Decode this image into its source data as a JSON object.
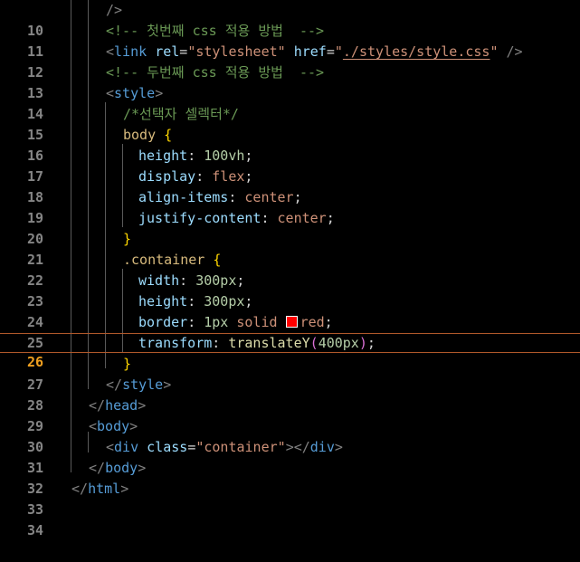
{
  "editor": {
    "current_line": 26,
    "lines": [
      {
        "num": "10",
        "text": "/>"
      },
      {
        "num": "11",
        "text": "<!-- 첫번째 css 적용 방법  -->"
      },
      {
        "num": "12",
        "text": "<link rel=\"stylesheet\" href=\"./styles/style.css\" />"
      },
      {
        "num": "13",
        "text": "<!-- 두번째 css 적용 방법  -->"
      },
      {
        "num": "14",
        "text": "<style>"
      },
      {
        "num": "15",
        "text": "/*선택자 셀렉터*/"
      },
      {
        "num": "16",
        "text": "body {"
      },
      {
        "num": "17",
        "text": "height: 100vh;"
      },
      {
        "num": "18",
        "text": "display: flex;"
      },
      {
        "num": "19",
        "text": "align-items: center;"
      },
      {
        "num": "20",
        "text": "justify-content: center;"
      },
      {
        "num": "21",
        "text": "}"
      },
      {
        "num": "22",
        "text": ".container {"
      },
      {
        "num": "23",
        "text": "width: 300px;"
      },
      {
        "num": "24",
        "text": "height: 300px;"
      },
      {
        "num": "25",
        "text": "border: 1px solid red;"
      },
      {
        "num": "26",
        "text": "transform: translateY(400px);"
      },
      {
        "num": "27",
        "text": "}"
      },
      {
        "num": "28",
        "text": "</style>"
      },
      {
        "num": "29",
        "text": "</head>"
      },
      {
        "num": "30",
        "text": "<body>"
      },
      {
        "num": "31",
        "text": "<div class=\"container\"></div>"
      },
      {
        "num": "32",
        "text": "</body>"
      },
      {
        "num": "33",
        "text": "</html>"
      },
      {
        "num": "34",
        "text": ""
      }
    ]
  },
  "colors": {
    "background": "#000000",
    "line_number": "#858585",
    "current_line_number": "#f0a020",
    "current_line_border": "#b0582a",
    "color_swatch": "#ff0000"
  },
  "tokens": {
    "l10": {
      "punc": "/>"
    },
    "l11": {
      "comment": "<!-- 첫번째 css 적용 방법  -->"
    },
    "l12": {
      "open": "<",
      "tag": "link",
      "attr1": "rel",
      "eq1": "=",
      "val1": "\"stylesheet\"",
      "attr2": "href",
      "eq2": "=",
      "q_open": "\"",
      "path": "./styles/style.css",
      "q_close": "\"",
      "close": "/>"
    },
    "l13": {
      "comment": "<!-- 두번째 css 적용 방법  -->"
    },
    "l14": {
      "open": "<",
      "tag": "style",
      "close": ">"
    },
    "l15": {
      "comment": "/*선택자 셀렉터*/"
    },
    "l16": {
      "sel": "body",
      "brace": "{"
    },
    "l17": {
      "prop": "height",
      "colon": ":",
      "val": "100vh",
      "semi": ";"
    },
    "l18": {
      "prop": "display",
      "colon": ":",
      "val": "flex",
      "semi": ";"
    },
    "l19": {
      "prop": "align-items",
      "colon": ":",
      "val": "center",
      "semi": ";"
    },
    "l20": {
      "prop": "justify-content",
      "colon": ":",
      "val": "center",
      "semi": ";"
    },
    "l21": {
      "brace": "}"
    },
    "l22": {
      "sel": ".container",
      "brace": "{"
    },
    "l23": {
      "prop": "width",
      "colon": ":",
      "val": "300px",
      "semi": ";"
    },
    "l24": {
      "prop": "height",
      "colon": ":",
      "val": "300px",
      "semi": ";"
    },
    "l25": {
      "prop": "border",
      "colon": ":",
      "num": "1px",
      "kw": "solid",
      "color": "red",
      "semi": ";"
    },
    "l26": {
      "prop": "transform",
      "colon": ":",
      "fn": "translateY",
      "p_open": "(",
      "num": "400px",
      "p_close": ")",
      "semi": ";"
    },
    "l27": {
      "brace": "}"
    },
    "l28": {
      "open": "</",
      "tag": "style",
      "close": ">"
    },
    "l29": {
      "open": "</",
      "tag": "head",
      "close": ">"
    },
    "l30": {
      "open": "<",
      "tag": "body",
      "close": ">"
    },
    "l31": {
      "open": "<",
      "tag": "div",
      "attr": "class",
      "eq": "=",
      "val": "\"container\"",
      "close": ">",
      "open2": "</",
      "tag2": "div",
      "close2": ">"
    },
    "l32": {
      "open": "</",
      "tag": "body",
      "close": ">"
    },
    "l33": {
      "open": "</",
      "tag": "html",
      "close": ">"
    }
  }
}
